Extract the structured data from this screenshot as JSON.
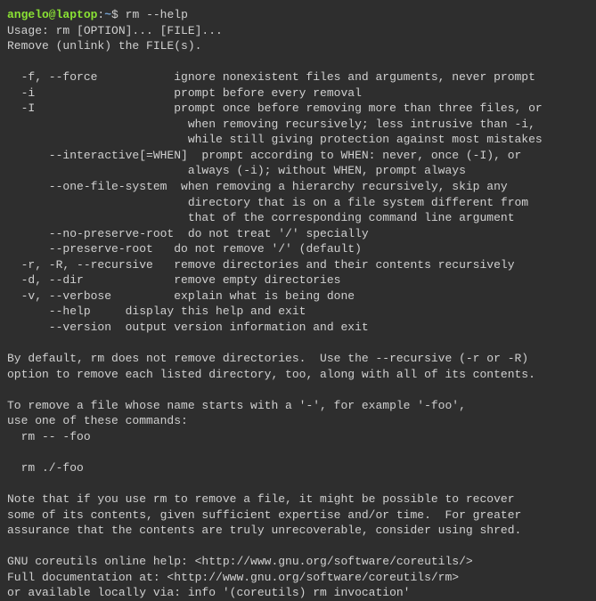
{
  "prompt": {
    "user": "angelo@laptop",
    "separator": ":",
    "path": "~",
    "symbol": "$"
  },
  "command": "rm --help",
  "output": {
    "usage": "Usage: rm [OPTION]... [FILE]...",
    "description": "Remove (unlink) the FILE(s).",
    "options": [
      "  -f, --force           ignore nonexistent files and arguments, never prompt",
      "  -i                    prompt before every removal",
      "  -I                    prompt once before removing more than three files, or",
      "                          when removing recursively; less intrusive than -i,",
      "                          while still giving protection against most mistakes",
      "      --interactive[=WHEN]  prompt according to WHEN: never, once (-I), or",
      "                          always (-i); without WHEN, prompt always",
      "      --one-file-system  when removing a hierarchy recursively, skip any",
      "                          directory that is on a file system different from",
      "                          that of the corresponding command line argument",
      "      --no-preserve-root  do not treat '/' specially",
      "      --preserve-root   do not remove '/' (default)",
      "  -r, -R, --recursive   remove directories and their contents recursively",
      "  -d, --dir             remove empty directories",
      "  -v, --verbose         explain what is being done",
      "      --help     display this help and exit",
      "      --version  output version information and exit"
    ],
    "notes": [
      "By default, rm does not remove directories.  Use the --recursive (-r or -R)",
      "option to remove each listed directory, too, along with all of its contents.",
      "",
      "To remove a file whose name starts with a '-', for example '-foo',",
      "use one of these commands:",
      "  rm -- -foo",
      "",
      "  rm ./-foo",
      "",
      "Note that if you use rm to remove a file, it might be possible to recover",
      "some of its contents, given sufficient expertise and/or time.  For greater",
      "assurance that the contents are truly unrecoverable, consider using shred.",
      "",
      "GNU coreutils online help: <http://www.gnu.org/software/coreutils/>",
      "Full documentation at: <http://www.gnu.org/software/coreutils/rm>",
      "or available locally via: info '(coreutils) rm invocation'"
    ]
  }
}
